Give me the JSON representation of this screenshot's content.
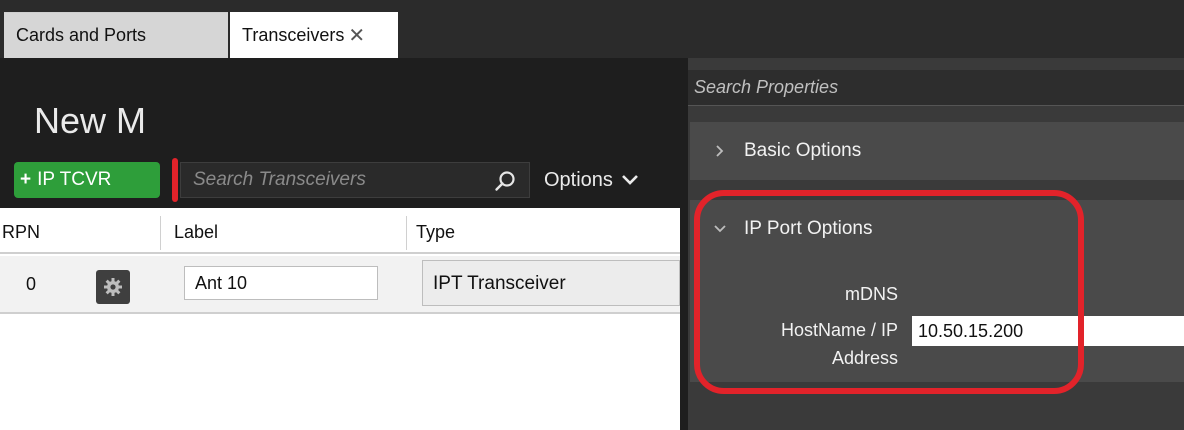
{
  "tabs": [
    {
      "label": "Cards and Ports"
    },
    {
      "label": "Transceivers",
      "close_glyph": "✕"
    }
  ],
  "left": {
    "title": "New M",
    "add_button": {
      "plus": "+",
      "label": "IP TCVR"
    },
    "search": {
      "placeholder": "Search Transceivers",
      "icon": "search-icon"
    },
    "options_label": "Options"
  },
  "table": {
    "columns": [
      "RPN",
      "Label",
      "Type"
    ],
    "rows": [
      {
        "rpn": "0",
        "action_icon": "gear-icon",
        "label": "Ant 10",
        "type": "IPT Transceiver"
      }
    ]
  },
  "properties": {
    "search_placeholder": "Search Properties",
    "sections": [
      {
        "title": "Basic Options",
        "expanded": false
      },
      {
        "title": "IP Port Options",
        "expanded": true
      }
    ],
    "fields": {
      "mdns_label_line1": "mDNS",
      "mdns_label_line2": "HostName / IP",
      "mdns_label_line3": "Address",
      "mdns_value": "10.50.15.200"
    }
  },
  "colors": {
    "accent_green": "#2e9e3a",
    "highlight_red": "#e2232a",
    "panel_dark": "#1e1e1e",
    "panel_gray": "#4a4a4a"
  }
}
